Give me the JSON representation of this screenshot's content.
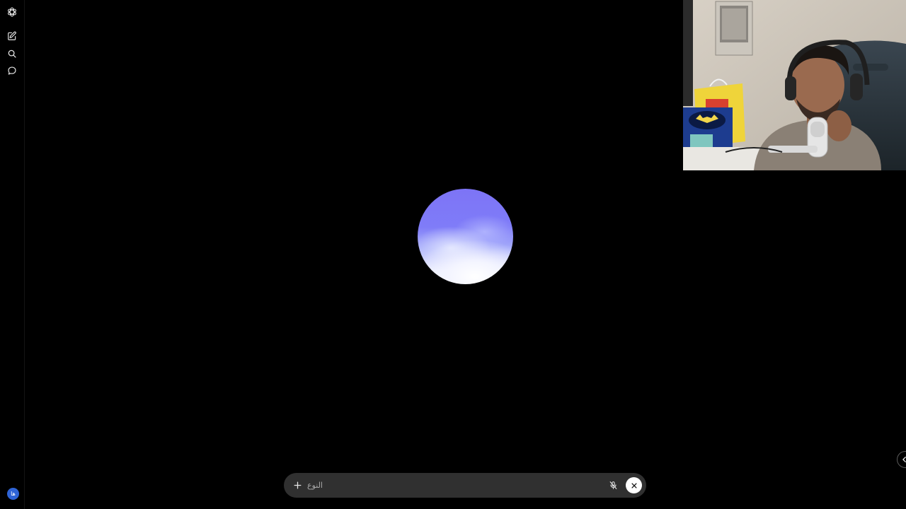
{
  "sidebar": {
    "avatar_initials": "ها",
    "avatar_color": "#2f64d6",
    "items": [
      {
        "name": "app-logo",
        "icon": "openai-knot-icon"
      },
      {
        "name": "new-chat",
        "icon": "pencil-square-icon"
      },
      {
        "name": "search-chats",
        "icon": "search-icon"
      },
      {
        "name": "chats",
        "icon": "chat-bubble-icon"
      }
    ]
  },
  "voice": {
    "orb_colors": [
      "#7d74f6",
      "#a6acfb",
      "#f6f7ff"
    ]
  },
  "composer": {
    "placeholder": "النوع",
    "value": "",
    "plus_icon": "plus-icon",
    "mic_icon": "mic-muted-icon",
    "close_icon": "close-icon",
    "background": "#303030"
  },
  "webcam": {
    "description_visible": false
  },
  "edge_handle": {
    "icon": "chevron-left-icon"
  }
}
